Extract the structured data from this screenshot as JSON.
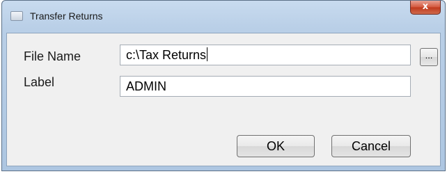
{
  "window": {
    "title": "Transfer Returns",
    "close_glyph": "x"
  },
  "form": {
    "file_name": {
      "label": "File Name",
      "value": "c:\\Tax Returns",
      "browse_label": "..."
    },
    "label_field": {
      "label": "Label",
      "value": "ADMIN"
    }
  },
  "buttons": {
    "ok": "OK",
    "cancel": "Cancel"
  },
  "icons": {
    "app": "window-icon",
    "close": "close-icon"
  }
}
